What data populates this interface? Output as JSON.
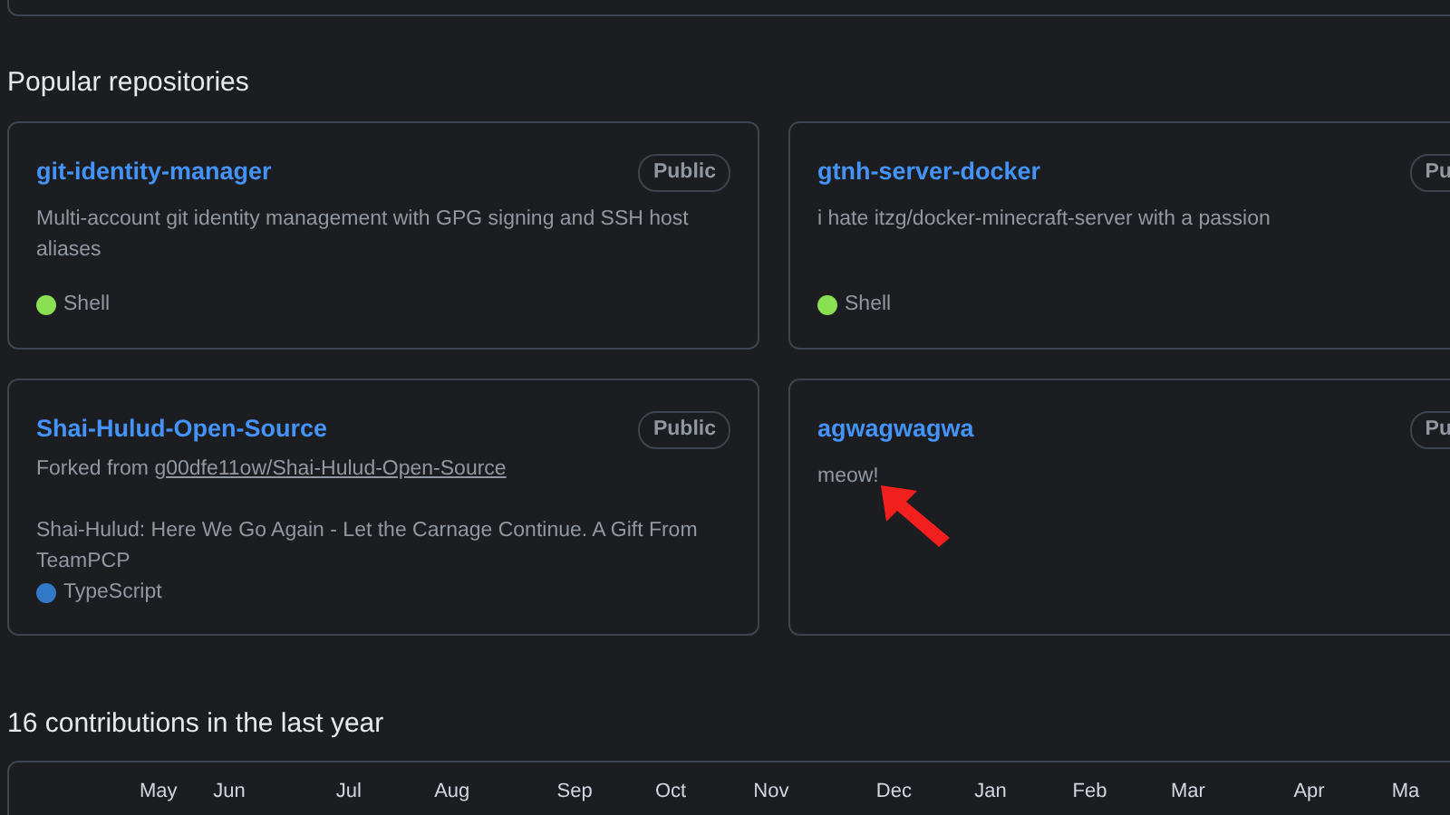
{
  "section_title": "Popular repositories",
  "repositories": [
    {
      "name": "git-identity-manager",
      "visibility": "Public",
      "description": "Multi-account git identity management with GPG signing and SSH host aliases",
      "language": "Shell",
      "color": "#89e051"
    },
    {
      "name": "gtnh-server-docker",
      "visibility": "Pu",
      "description": "i hate itzg/docker-minecraft-server with a passion",
      "language": "Shell",
      "color": "#89e051"
    },
    {
      "name": "Shai-Hulud-Open-Source",
      "visibility": "Public",
      "forked_from": {
        "prefix": "Forked from",
        "link": "g00dfe11ow/Shai-Hulud-Open-Source"
      },
      "description": "Shai-Hulud: Here We Go Again - Let the Carnage Continue. A Gift From TeamPCP",
      "language": "TypeScript",
      "color": "#3178c6"
    },
    {
      "name": "agwagwagwa",
      "visibility": "Pu",
      "description": "meow!"
    }
  ],
  "contributions": {
    "title": "16 contributions in the last year",
    "months": [
      "May",
      "Jun",
      "Jul",
      "Aug",
      "Sep",
      "Oct",
      "Nov",
      "Dec",
      "Jan",
      "Feb",
      "Mar",
      "Apr",
      "Ma"
    ]
  }
}
